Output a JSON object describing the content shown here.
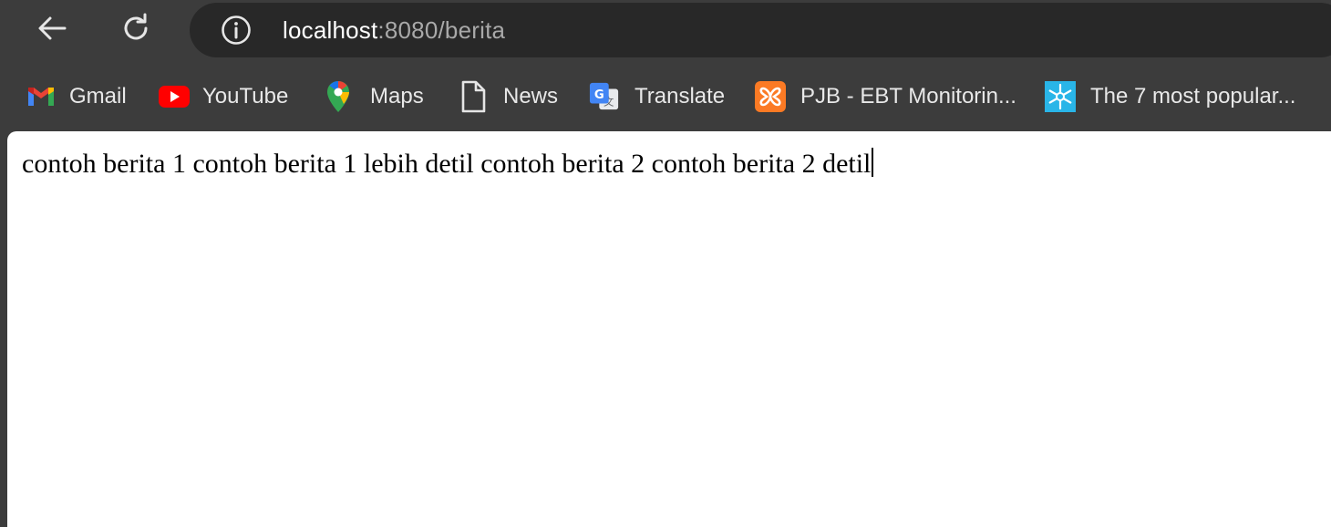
{
  "toolbar": {
    "back_icon": "back-arrow-icon",
    "reload_icon": "reload-icon",
    "address": {
      "info_icon": "info-icon",
      "host": "localhost",
      "rest": ":8080/berita"
    }
  },
  "bookmarks": [
    {
      "label": "Gmail",
      "icon": "gmail-icon"
    },
    {
      "label": "YouTube",
      "icon": "youtube-icon"
    },
    {
      "label": "Maps",
      "icon": "maps-icon"
    },
    {
      "label": "News",
      "icon": "document-icon"
    },
    {
      "label": "Translate",
      "icon": "translate-icon"
    },
    {
      "label": "PJB - EBT Monitorin...",
      "icon": "xampp-icon"
    },
    {
      "label": "The 7 most popular...",
      "icon": "snowflake-icon"
    }
  ],
  "page": {
    "text": "contoh berita 1 contoh berita 1 lebih detil contoh berita 2 contoh berita 2 detil"
  },
  "colors": {
    "toolbar_bg": "#3c3c3c",
    "omnibox_bg": "#282828",
    "url_host": "#ffffff",
    "url_rest": "#a9a9a9",
    "bookmark_text": "#e8e8e8",
    "page_bg": "#ffffff"
  }
}
